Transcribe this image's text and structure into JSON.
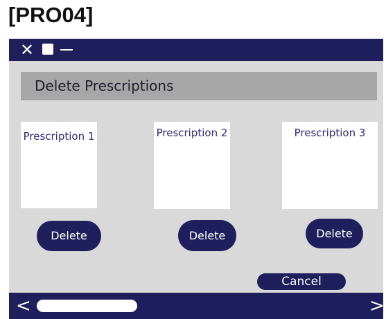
{
  "doc_label": "[PRO04]",
  "window": {
    "controls": {
      "close_icon": "✕",
      "maximize_icon": "square-icon",
      "minimize_icon": "minus-icon"
    }
  },
  "header": {
    "title": "Delete Prescriptions"
  },
  "prescriptions": [
    {
      "title": "Prescription 1",
      "button_label": "Delete"
    },
    {
      "title": "Prescription 2",
      "button_label": "Delete"
    },
    {
      "title": "Prescription 3",
      "button_label": "Delete"
    }
  ],
  "footer": {
    "cancel_label": "Cancel",
    "prev_icon": "<",
    "next_icon": ">"
  },
  "colors": {
    "bar": "#1f1f5e",
    "window_bg": "#d9d9d9",
    "header_bg": "#a6a6a6",
    "card_text": "#2b2b7a"
  }
}
